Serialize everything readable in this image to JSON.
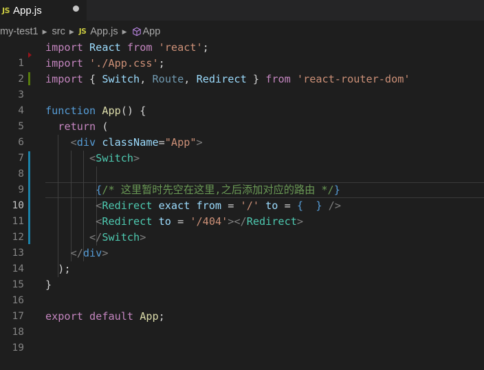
{
  "tab": {
    "file_icon": "JS",
    "title": "App.js"
  },
  "breadcrumb": {
    "items": [
      "my-test1",
      "src",
      "App.js",
      "App"
    ],
    "file_icon": "JS",
    "symbol_icon": "cube-icon"
  },
  "editor": {
    "line_numbers": [
      "1",
      "2",
      "3",
      "4",
      "5",
      "6",
      "7",
      "8",
      "9",
      "10",
      "11",
      "12",
      "13",
      "14",
      "15",
      "16",
      "17",
      "18",
      "19"
    ],
    "active_line": 10,
    "colors": {
      "keyword": "#569cd6",
      "control_keyword": "#c586c0",
      "string": "#ce9178",
      "comment": "#6a9955",
      "component_tag": "#4ec9b0",
      "function": "#dcdcaa"
    },
    "tokens": {
      "l1": [
        "import",
        "React",
        "from",
        "'react'",
        ";"
      ],
      "l2": [
        "import",
        "'./App.css'",
        ";"
      ],
      "l3": [
        "import",
        "{",
        "Switch",
        ",",
        "Route",
        ",",
        "Redirect",
        "}",
        "from",
        "'react-router-dom'"
      ],
      "l5": [
        "function",
        "App",
        "()",
        "{"
      ],
      "l6": [
        "return",
        "("
      ],
      "l7": [
        "<",
        "div",
        "className",
        "=",
        "\"App\"",
        ">"
      ],
      "l8": [
        "<",
        "Switch",
        ">"
      ],
      "l10": [
        "{",
        "/* 这里暂时先空在这里,之后添加对应的路由 */",
        "}"
      ],
      "l11": [
        "<",
        "Redirect",
        "exact",
        "from",
        "=",
        "'/'",
        "to",
        "=",
        "{",
        "}",
        "/>"
      ],
      "l12": [
        "<",
        "Redirect",
        "to",
        "=",
        "'/404'",
        "></",
        "Redirect",
        ">"
      ],
      "l13": [
        "</",
        "Switch",
        ">"
      ],
      "l14": [
        "</",
        "div",
        ">"
      ],
      "l15": [
        ");"
      ],
      "l16": [
        "}"
      ],
      "l18": [
        "export",
        "default",
        "App",
        ";"
      ]
    }
  }
}
